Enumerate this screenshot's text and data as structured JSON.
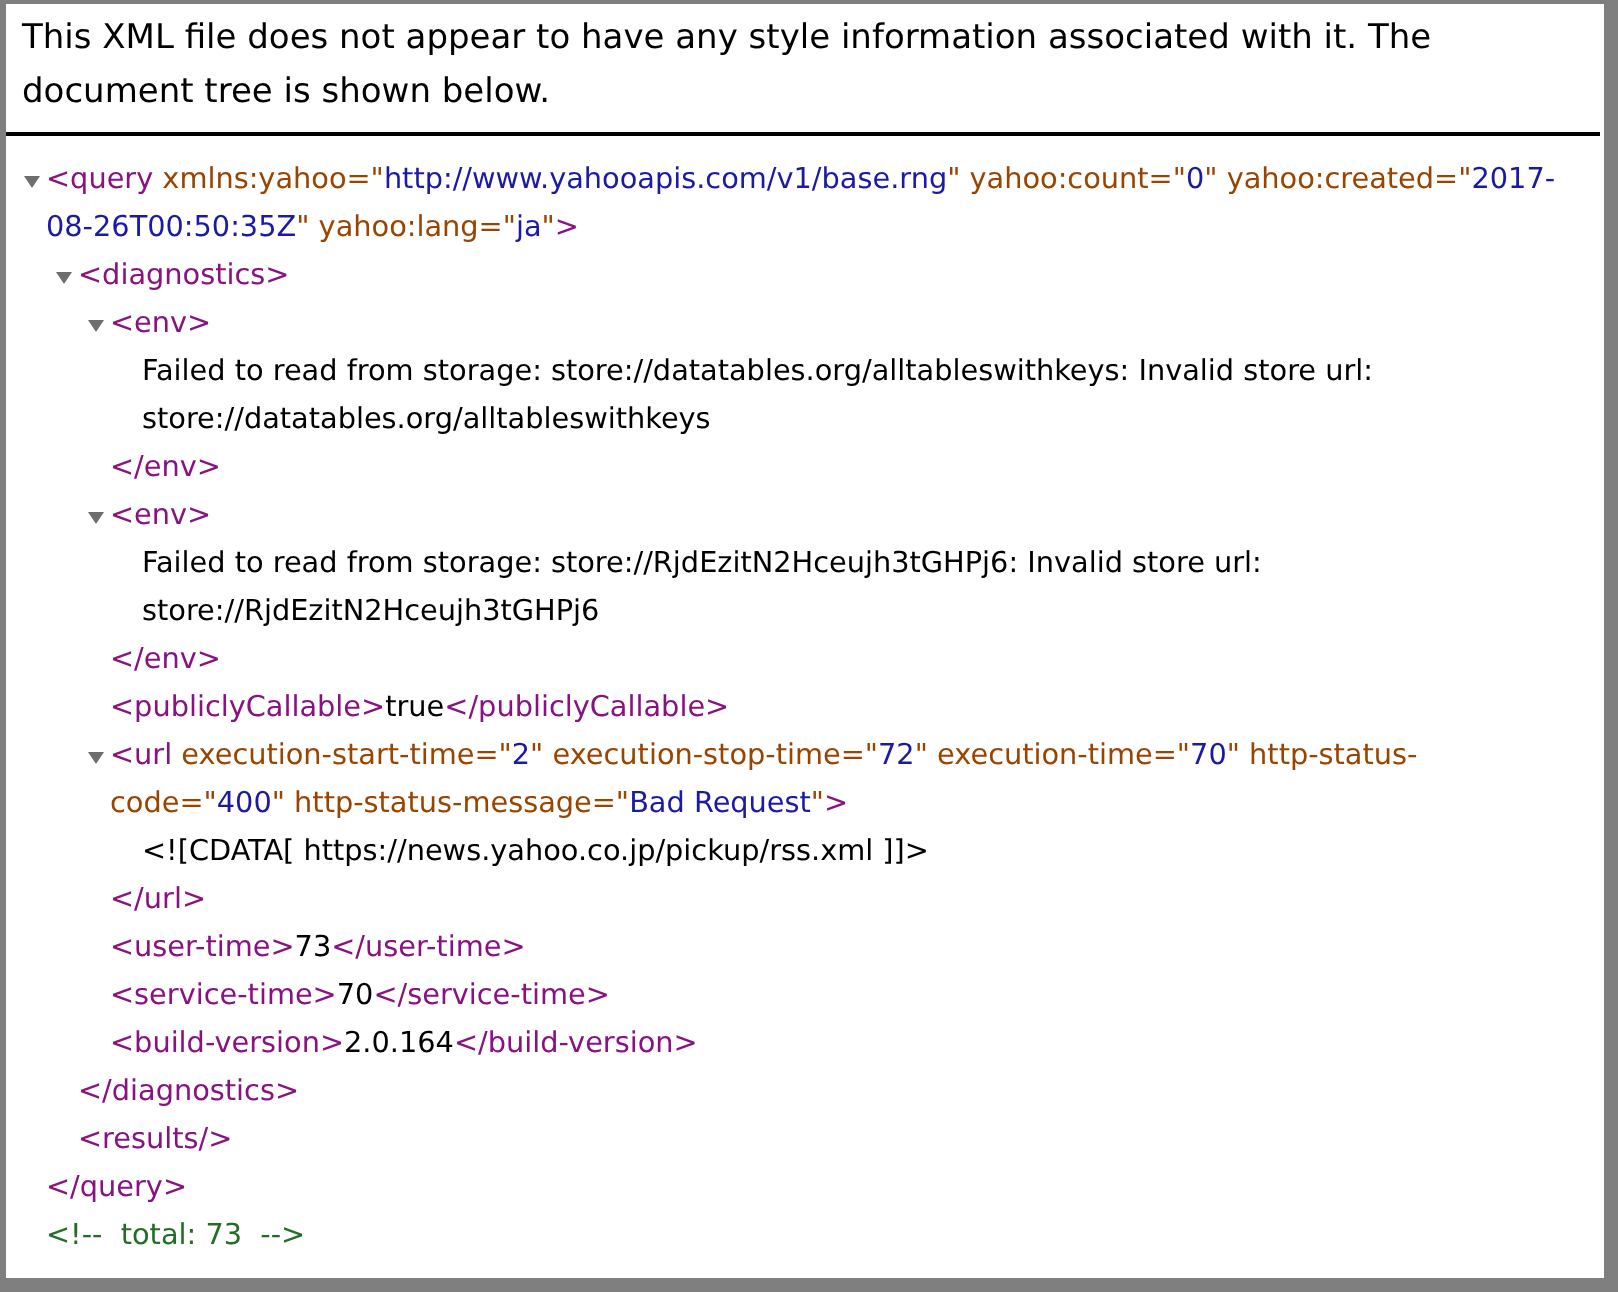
{
  "notice": "This XML file does not appear to have any style information associated with it. The document tree is shown below.",
  "tree": [
    {
      "kind": "element",
      "expanded": true,
      "open": [
        {
          "kind": "tag",
          "text": "<query"
        },
        {
          "kind": "attr",
          "text": " xmlns:yahoo=\""
        },
        {
          "kind": "value",
          "text": "http://www.yahooapis.com/v1/base.rng"
        },
        {
          "kind": "attr",
          "text": "\" yahoo:count=\""
        },
        {
          "kind": "value",
          "text": "0"
        },
        {
          "kind": "attr",
          "text": "\" yahoo:created=\""
        },
        {
          "kind": "value",
          "text": "2017-08-26T00:50:35Z"
        },
        {
          "kind": "attr",
          "text": "\" yahoo:lang=\""
        },
        {
          "kind": "value",
          "text": "ja"
        },
        {
          "kind": "attr",
          "text": "\""
        },
        {
          "kind": "tag",
          "text": ">"
        }
      ],
      "close": [
        {
          "kind": "tag",
          "text": "</query>"
        }
      ],
      "children": [
        {
          "kind": "element",
          "expanded": true,
          "open": [
            {
              "kind": "tag",
              "text": "<diagnostics>"
            }
          ],
          "close": [
            {
              "kind": "tag",
              "text": "</diagnostics>"
            }
          ],
          "children": [
            {
              "kind": "element",
              "expanded": true,
              "open": [
                {
                  "kind": "tag",
                  "text": "<env>"
                }
              ],
              "close": [
                {
                  "kind": "tag",
                  "text": "</env>"
                }
              ],
              "children": [
                {
                  "kind": "line",
                  "parts": [
                    {
                      "kind": "text",
                      "text": "Failed to read from storage: store://datatables.org/alltableswithkeys: Invalid store url: store://datatables.org/alltableswithkeys"
                    }
                  ]
                }
              ]
            },
            {
              "kind": "element",
              "expanded": true,
              "open": [
                {
                  "kind": "tag",
                  "text": "<env>"
                }
              ],
              "close": [
                {
                  "kind": "tag",
                  "text": "</env>"
                }
              ],
              "children": [
                {
                  "kind": "line",
                  "parts": [
                    {
                      "kind": "text",
                      "text": "Failed to read from storage: store://RjdEzitN2Hceujh3tGHPj6: Invalid store url: store://RjdEzitN2Hceujh3tGHPj6"
                    }
                  ]
                }
              ]
            },
            {
              "kind": "line",
              "parts": [
                {
                  "kind": "tag",
                  "text": "<publiclyCallable>"
                },
                {
                  "kind": "text",
                  "text": "true"
                },
                {
                  "kind": "tag",
                  "text": "</publiclyCallable>"
                }
              ]
            },
            {
              "kind": "element",
              "expanded": true,
              "open": [
                {
                  "kind": "tag",
                  "text": "<url"
                },
                {
                  "kind": "attr",
                  "text": " execution-start-time=\""
                },
                {
                  "kind": "value",
                  "text": "2"
                },
                {
                  "kind": "attr",
                  "text": "\" execution-stop-time=\""
                },
                {
                  "kind": "value",
                  "text": "72"
                },
                {
                  "kind": "attr",
                  "text": "\" execution-time=\""
                },
                {
                  "kind": "value",
                  "text": "70"
                },
                {
                  "kind": "attr",
                  "text": "\" http-status-code=\""
                },
                {
                  "kind": "value",
                  "text": "400"
                },
                {
                  "kind": "attr",
                  "text": "\" http-status-message=\""
                },
                {
                  "kind": "value",
                  "text": "Bad Request"
                },
                {
                  "kind": "attr",
                  "text": "\""
                },
                {
                  "kind": "tag",
                  "text": ">"
                }
              ],
              "close": [
                {
                  "kind": "tag",
                  "text": "</url>"
                }
              ],
              "children": [
                {
                  "kind": "line",
                  "parts": [
                    {
                      "kind": "text",
                      "text": "<![CDATA[ https://news.yahoo.co.jp/pickup/rss.xml ]]>"
                    }
                  ]
                }
              ]
            },
            {
              "kind": "line",
              "parts": [
                {
                  "kind": "tag",
                  "text": "<user-time>"
                },
                {
                  "kind": "text",
                  "text": "73"
                },
                {
                  "kind": "tag",
                  "text": "</user-time>"
                }
              ]
            },
            {
              "kind": "line",
              "parts": [
                {
                  "kind": "tag",
                  "text": "<service-time>"
                },
                {
                  "kind": "text",
                  "text": "70"
                },
                {
                  "kind": "tag",
                  "text": "</service-time>"
                }
              ]
            },
            {
              "kind": "line",
              "parts": [
                {
                  "kind": "tag",
                  "text": "<build-version>"
                },
                {
                  "kind": "text",
                  "text": "2.0.164"
                },
                {
                  "kind": "tag",
                  "text": "</build-version>"
                }
              ]
            }
          ]
        },
        {
          "kind": "line",
          "parts": [
            {
              "kind": "tag",
              "text": "<results/>"
            }
          ]
        }
      ]
    },
    {
      "kind": "line",
      "parts": [
        {
          "kind": "comment",
          "text": "<!--  total: 73  -->"
        }
      ]
    }
  ]
}
